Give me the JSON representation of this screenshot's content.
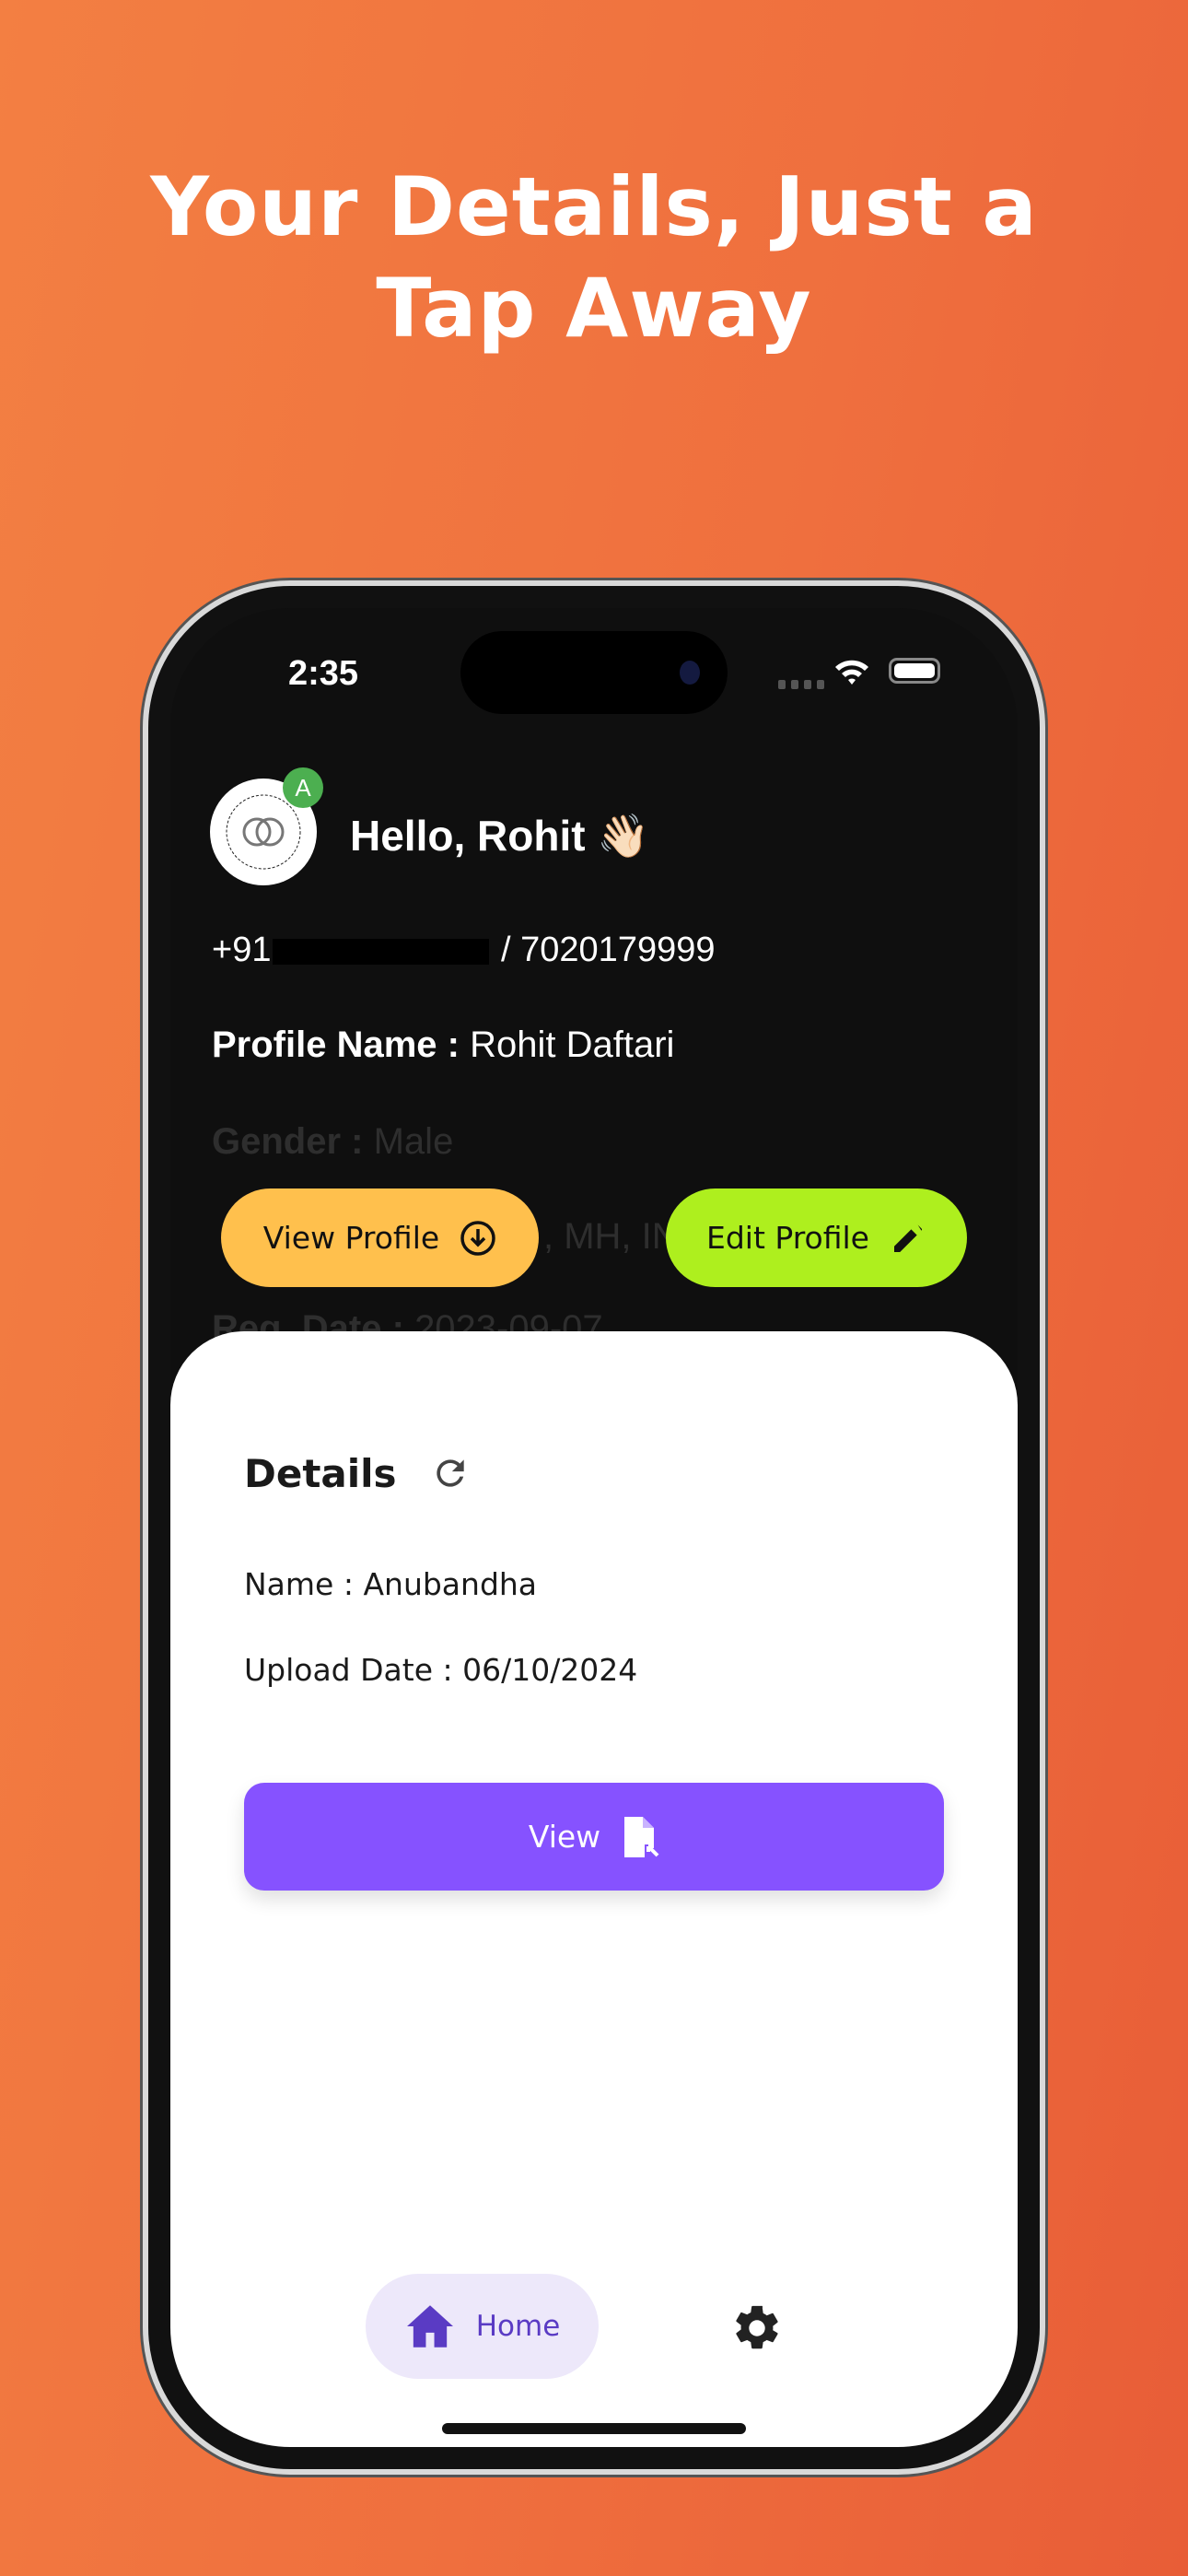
{
  "headline": {
    "line1": "Your Details, Just a",
    "line2": "Tap Away"
  },
  "status_bar": {
    "time": "2:35"
  },
  "profile": {
    "avatar_badge": "A",
    "greeting": "Hello, Rohit 👋🏻",
    "phone_prefix": "+91",
    "phone_suffix": "/ 7020179999",
    "profile_name_label": "Profile Name :",
    "profile_name": "Rohit Daftari",
    "gender_label": "Gender :",
    "gender": "Male",
    "address_partial": ", MH, IN",
    "reg_date_label": "Reg. Date :",
    "reg_date": "2023-09-07"
  },
  "actions": {
    "view_profile": "View Profile",
    "edit_profile": "Edit Profile"
  },
  "details": {
    "title": "Details",
    "name_line": "Name : Anubandha",
    "upload_line": "Upload Date :  06/10/2024",
    "view_button": "View"
  },
  "nav": {
    "home": "Home"
  },
  "colors": {
    "view_profile": "#FFC04D",
    "edit_profile": "#AEEF1E",
    "view_button": "#8652FF",
    "nav_active": "#5A3BC4"
  },
  "icons": {
    "download": "download-circle-icon",
    "edit": "pencil-icon",
    "refresh": "refresh-icon",
    "file": "file-open-icon",
    "home": "home-icon",
    "settings": "gear-icon"
  }
}
